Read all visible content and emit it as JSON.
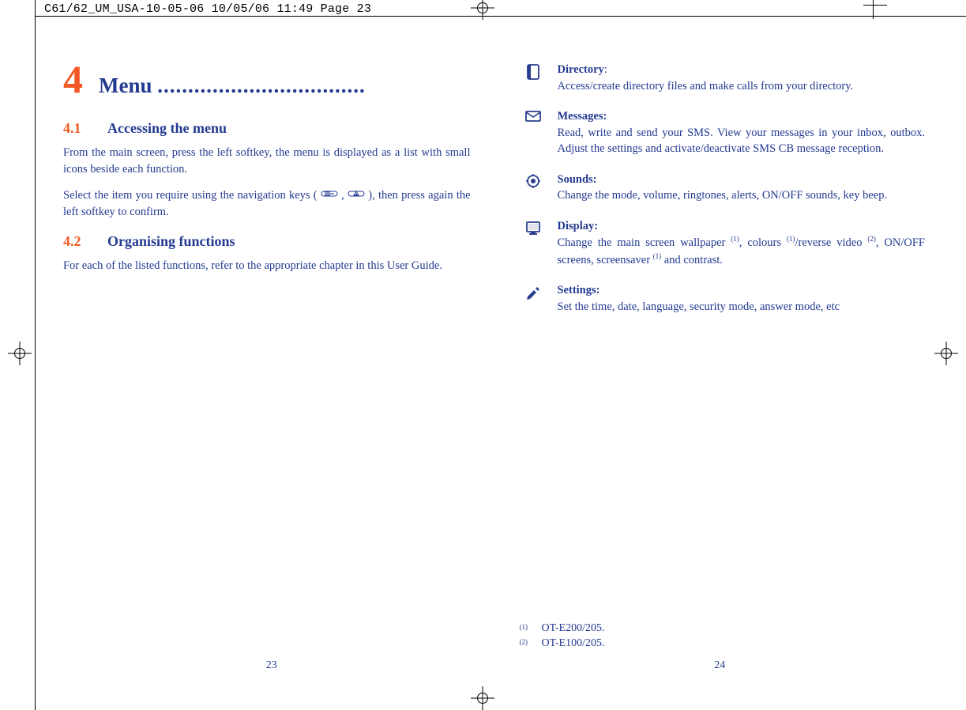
{
  "print_header": "C61/62_UM_USA-10-05-06  10/05/06  11:49  Page 23",
  "left_page": {
    "chapter_number": "4",
    "chapter_title": "Menu ",
    "chapter_dots": "..................................",
    "sections": [
      {
        "num": "4.1",
        "title": "Accessing the menu",
        "paragraphs": [
          "From the main screen, press the left softkey, the menu is displayed as a list with small icons beside each function.",
          "Select the item you require using the navigation keys (       ,       ), then press again the left softkey to confirm."
        ]
      },
      {
        "num": "4.2",
        "title": "Organising functions",
        "paragraphs": [
          "For each of the listed functions, refer to the appropriate chapter in this User Guide."
        ]
      }
    ],
    "page_number": "23"
  },
  "right_page": {
    "items": [
      {
        "icon": "directory-icon",
        "title": "Directory",
        "title_suffix": ":",
        "desc": "Access/create directory files and make calls from your directory."
      },
      {
        "icon": "messages-icon",
        "title": "Messages:",
        "title_suffix": "",
        "desc": "Read, write and send your SMS. View your messages in your inbox, outbox. Adjust the settings and activate/deactivate SMS CB message reception."
      },
      {
        "icon": "sounds-icon",
        "title": "Sounds:",
        "title_suffix": "",
        "desc": "Change the mode, volume, ringtones, alerts, ON/OFF sounds, key beep."
      },
      {
        "icon": "display-icon",
        "title": "Display:",
        "title_suffix": "",
        "desc_html": "Change the main screen wallpaper <sup>(1)</sup>, colours <sup>(1)</sup>/reverse video <sup>(2)</sup>, ON/OFF screens, screensaver <sup>(1)</sup> and contrast."
      },
      {
        "icon": "settings-icon",
        "title": "Settings:",
        "title_suffix": "",
        "desc": "Set the time, date, language, security mode, answer mode, etc"
      }
    ],
    "footnotes": [
      {
        "mark": "(1)",
        "text": "OT-E200/205."
      },
      {
        "mark": "(2)",
        "text": "OT-E100/205."
      }
    ],
    "page_number": "24"
  }
}
